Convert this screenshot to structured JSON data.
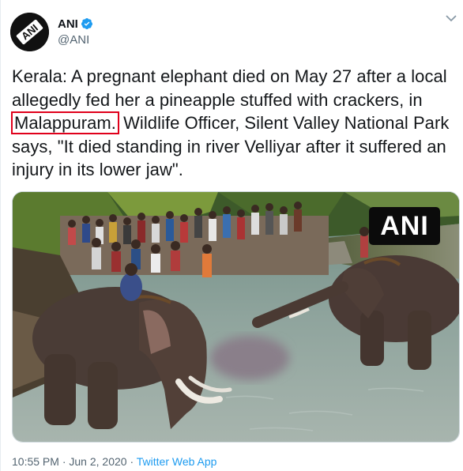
{
  "author": {
    "display_name": "ANI",
    "handle": "@ANI",
    "avatar_text": "ANI",
    "verified": true,
    "verified_color": "#1d9bf0"
  },
  "tweet": {
    "text_before": "Kerala: A pregnant elephant died on May 27 after a local allegedly fed her a pineapple stuffed with crackers, in ",
    "highlighted": "Malappuram.",
    "text_after": " Wildlife Officer, Silent Valley National Park says, \"It died standing in river Velliyar after it suffered an injury in its lower jaw\".",
    "highlight_color": "#e0001b"
  },
  "media": {
    "watermark": "ANI",
    "description_icon": "photo"
  },
  "meta": {
    "time": "10:55 PM",
    "separator": "·",
    "date": "Jun 2, 2020",
    "source": "Twitter Web App"
  }
}
